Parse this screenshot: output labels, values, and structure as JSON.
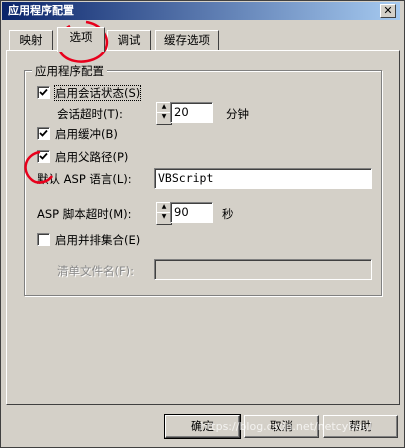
{
  "window": {
    "title": "应用程序配置",
    "close_glyph": "✕"
  },
  "tabs": [
    {
      "label": "映射"
    },
    {
      "label": "选项"
    },
    {
      "label": "调试"
    },
    {
      "label": "缓存选项"
    }
  ],
  "group": {
    "label": "应用程序配置",
    "enable_session": {
      "label": "启用会话状态(S)",
      "checked": true
    },
    "session_timeout": {
      "label": "会话超时(T):",
      "value": "20",
      "unit": "分钟"
    },
    "enable_buffer": {
      "label": "启用缓冲(B)",
      "checked": true
    },
    "enable_parent_paths": {
      "label": "启用父路径(P)",
      "checked": true
    },
    "default_language": {
      "label": "默认 ASP 语言(L):",
      "value": "VBScript"
    },
    "script_timeout": {
      "label": "ASP 脚本超时(M):",
      "value": "90",
      "unit": "秒"
    },
    "enable_side_by_side": {
      "label": "启用并排集合(E)",
      "checked": false
    },
    "manifest_file": {
      "label": "清单文件名(F):",
      "value": ""
    }
  },
  "buttons": {
    "ok": "确定",
    "cancel": "取消",
    "help": "帮助"
  },
  "watermark": "https://blog.csdn.net/netcyboul",
  "colors": {
    "annotation_red": "#e8001c",
    "title_bar": "#0a246a"
  }
}
